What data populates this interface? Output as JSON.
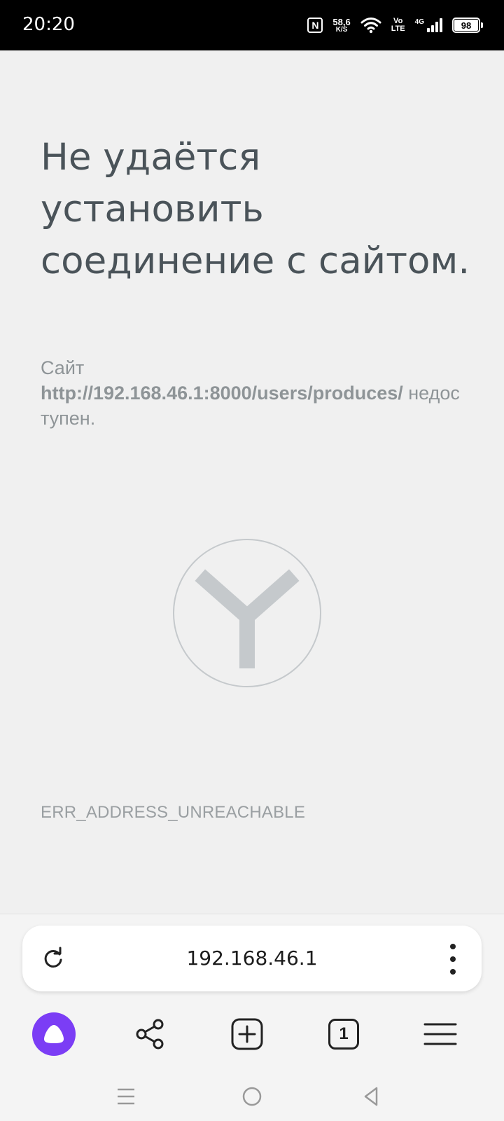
{
  "status_bar": {
    "time": "20:20",
    "nfc_label": "N",
    "speed_value": "58,6",
    "speed_unit": "K/S",
    "volte_top": "Vo",
    "volte_bottom": "LTE",
    "network_type": "4G",
    "battery_level": "98"
  },
  "error_page": {
    "title": "Не удаётся установить соединение с сайтом.",
    "desc_prefix": "Сайт",
    "url": "http://192.168.46.1:8000/users/produces/",
    "desc_suffix": "недоступен.",
    "error_code": "ERR_ADDRESS_UNREACHABLE",
    "logo_icon": "yandex-browser-logo-icon",
    "logo_color": "#c5c9cc"
  },
  "address_bar": {
    "address": "192.168.46.1",
    "reload_icon": "reload-icon",
    "menu_icon": "kebab-menu-icon"
  },
  "toolbar": {
    "alice_icon": "alice-assistant-icon",
    "alice_color": "#7b3df5",
    "share_icon": "share-icon",
    "new_tab_icon": "plus-box-icon",
    "tabs_count": "1",
    "menu_icon": "hamburger-menu-icon"
  },
  "system_nav": {
    "recents_icon": "recents-icon",
    "home_icon": "home-icon",
    "back_icon": "back-icon"
  }
}
